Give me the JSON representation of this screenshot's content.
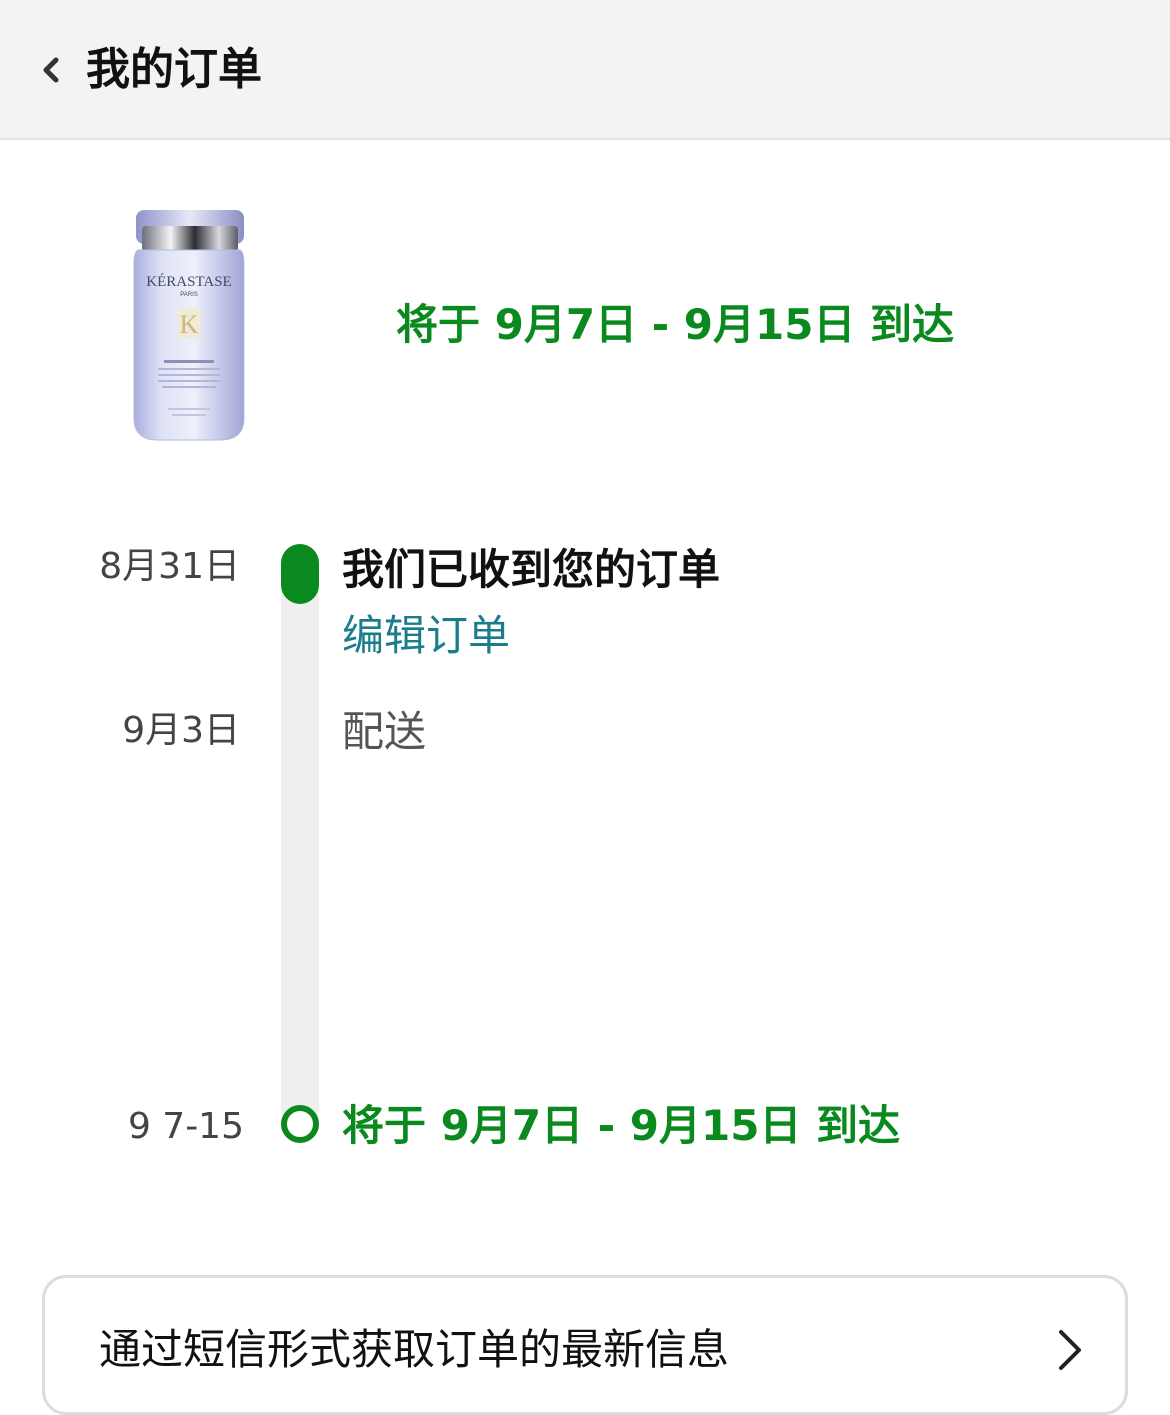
{
  "header": {
    "title": "我的订单",
    "back_icon": "chevron-left-icon"
  },
  "product": {
    "image_icon": "shampoo-bottle-icon",
    "brand_text": "KÉRASTASE",
    "brand_sub": "PARIS",
    "logo_letter": "K",
    "eta_text": "将于 9月7日 - 9月15日 到达"
  },
  "timeline": {
    "events": [
      {
        "date": "8月31日",
        "title": "我们已收到您的订单",
        "link": "编辑订单",
        "status": "completed"
      },
      {
        "date": "9月3日",
        "title": "配送",
        "status": "pending"
      },
      {
        "date": "9 7-15",
        "title": "将于 9月7日 - 9月15日 到达",
        "status": "upcoming"
      }
    ]
  },
  "sms_card": {
    "label": "通过短信形式获取订单的最新信息",
    "chevron_icon": "chevron-right-icon"
  },
  "colors": {
    "accent_green": "#0a8a1e",
    "link_teal": "#1a7d8c",
    "header_bg": "#f3f3f3",
    "track_gray": "#efefef"
  }
}
